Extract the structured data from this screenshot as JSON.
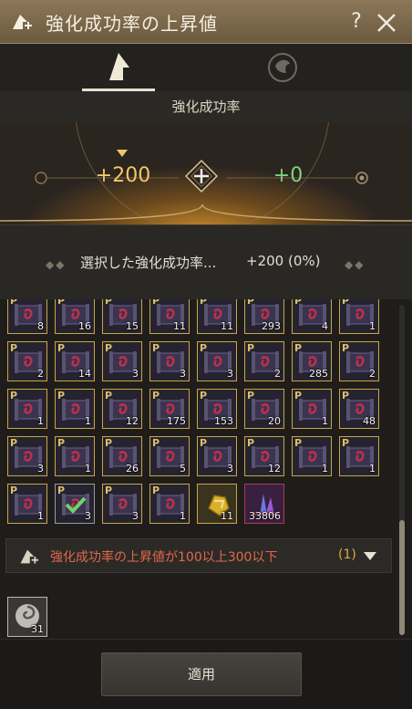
{
  "window": {
    "title": "強化成功率の上昇値",
    "help_label": "?"
  },
  "section": {
    "heading": "強化成功率"
  },
  "rate": {
    "current": "+200",
    "added": "+0"
  },
  "selected": {
    "label": "選択した強化成功率...",
    "value": "+200 (0%)"
  },
  "items": [
    {
      "count": "8",
      "type": "scroll"
    },
    {
      "count": "16",
      "type": "scroll"
    },
    {
      "count": "15",
      "type": "scroll"
    },
    {
      "count": "11",
      "type": "scroll"
    },
    {
      "count": "11",
      "type": "scroll"
    },
    {
      "count": "293",
      "type": "scroll"
    },
    {
      "count": "4",
      "type": "scroll"
    },
    {
      "count": "1",
      "type": "scroll"
    },
    {
      "count": "2",
      "type": "scroll"
    },
    {
      "count": "14",
      "type": "scroll"
    },
    {
      "count": "3",
      "type": "scroll"
    },
    {
      "count": "3",
      "type": "scroll"
    },
    {
      "count": "3",
      "type": "scroll"
    },
    {
      "count": "2",
      "type": "scroll"
    },
    {
      "count": "285",
      "type": "scroll"
    },
    {
      "count": "2",
      "type": "scroll"
    },
    {
      "count": "1",
      "type": "scroll"
    },
    {
      "count": "1",
      "type": "scroll"
    },
    {
      "count": "12",
      "type": "scroll"
    },
    {
      "count": "175",
      "type": "scroll"
    },
    {
      "count": "153",
      "type": "scroll"
    },
    {
      "count": "20",
      "type": "scroll"
    },
    {
      "count": "1",
      "type": "scroll"
    },
    {
      "count": "48",
      "type": "scroll"
    },
    {
      "count": "3",
      "type": "scroll"
    },
    {
      "count": "1",
      "type": "scroll"
    },
    {
      "count": "26",
      "type": "scroll"
    },
    {
      "count": "5",
      "type": "scroll"
    },
    {
      "count": "3",
      "type": "scroll"
    },
    {
      "count": "12",
      "type": "scroll"
    },
    {
      "count": "1",
      "type": "scroll"
    },
    {
      "count": "1",
      "type": "scroll"
    },
    {
      "count": "1",
      "type": "scroll"
    },
    {
      "count": "3",
      "type": "scroll-checked"
    },
    {
      "count": "3",
      "type": "scroll"
    },
    {
      "count": "1",
      "type": "scroll"
    },
    {
      "count": "11",
      "type": "gold-stone"
    },
    {
      "count": "33806",
      "type": "crystal"
    }
  ],
  "filter": {
    "label": "強化成功率の上昇値が100以上300以下",
    "count": "(1)"
  },
  "bottom_item": {
    "count": "31"
  },
  "footer": {
    "apply_label": "適用"
  },
  "colors": {
    "accent_gold": "#f3c766",
    "positive_green": "#7ed37a",
    "filter_red": "#e0674c"
  }
}
